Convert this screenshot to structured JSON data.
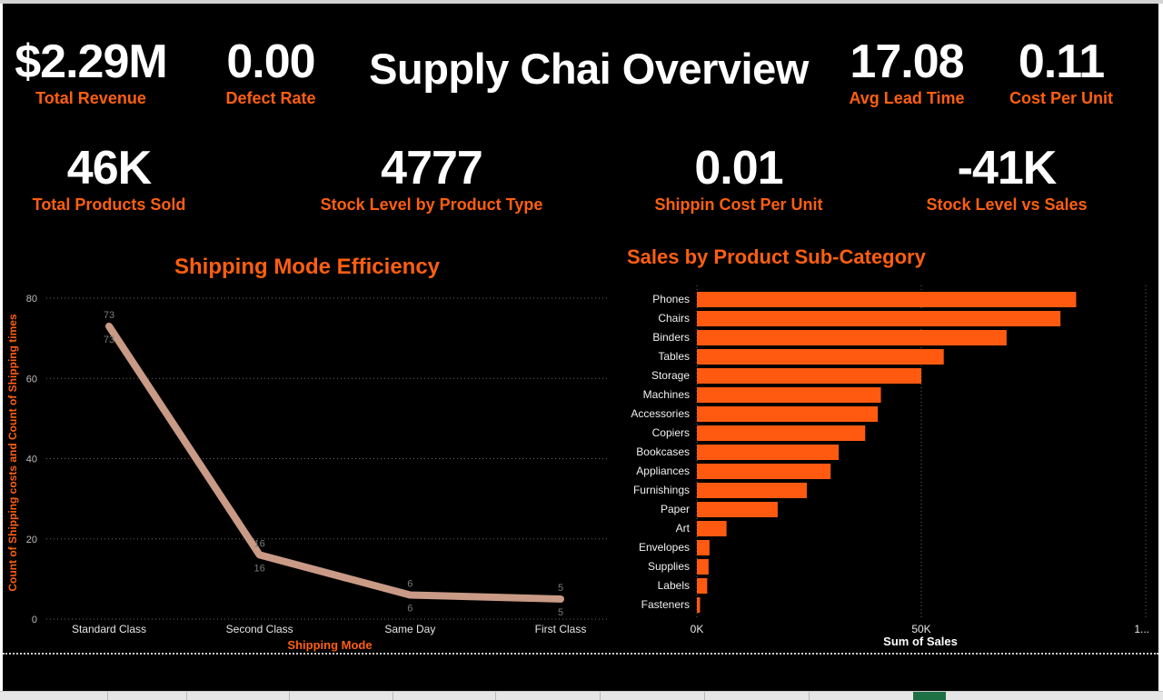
{
  "dashboard": {
    "title": "Supply Chai Overview",
    "kpis": [
      {
        "value": "$2.29M",
        "label": "Total Revenue"
      },
      {
        "value": "0.00",
        "label": "Defect Rate"
      },
      {
        "value": "17.08",
        "label": "Avg Lead Time"
      },
      {
        "value": "0.11",
        "label": "Cost Per Unit"
      },
      {
        "value": "46K",
        "label": "Total Products Sold"
      },
      {
        "value": "4777",
        "label": "Stock Level by Product Type"
      },
      {
        "value": "0.01",
        "label": "Shippin Cost Per Unit"
      },
      {
        "value": "-41K",
        "label": "Stock Level vs Sales"
      }
    ]
  },
  "colors": {
    "background": "#000000",
    "accent": "#ff5f0f",
    "line_series": "#c99a86",
    "bar": "#ff5a10"
  },
  "chart_data": [
    {
      "type": "line",
      "title": "Shipping Mode Efficiency",
      "xlabel": "Shipping Mode",
      "ylabel": "Count of Shipping costs and Count of Shipping times",
      "categories": [
        "Standard Class",
        "Second Class",
        "Same Day",
        "First Class"
      ],
      "series": [
        {
          "name": "",
          "values": [
            73,
            16,
            6,
            5
          ]
        }
      ],
      "data_labels_top": [
        "73",
        "16",
        "6",
        "5"
      ],
      "data_labels_bottom": [
        "73",
        "16",
        "6",
        "5"
      ],
      "ylim": [
        0,
        80
      ],
      "yticks": [
        "0",
        "20",
        "40",
        "60",
        "80"
      ],
      "grid": true
    },
    {
      "type": "bar",
      "orientation": "horizontal",
      "title": "Sales by Product Sub-Category",
      "xlabel": "Sum of Sales",
      "ylabel": "",
      "categories": [
        "Phones",
        "Chairs",
        "Binders",
        "Tables",
        "Storage",
        "Machines",
        "Accessories",
        "Copiers",
        "Bookcases",
        "Appliances",
        "Furnishings",
        "Paper",
        "Art",
        "Envelopes",
        "Supplies",
        "Labels",
        "Fasteners"
      ],
      "values": [
        84500,
        81000,
        69000,
        55000,
        50000,
        41000,
        40300,
        37500,
        31600,
        29800,
        24500,
        18000,
        6600,
        2800,
        2600,
        2300,
        700
      ],
      "xlim": [
        0,
        100000
      ],
      "xticks": [
        "0K",
        "50K",
        "1..."
      ],
      "grid": true
    }
  ]
}
